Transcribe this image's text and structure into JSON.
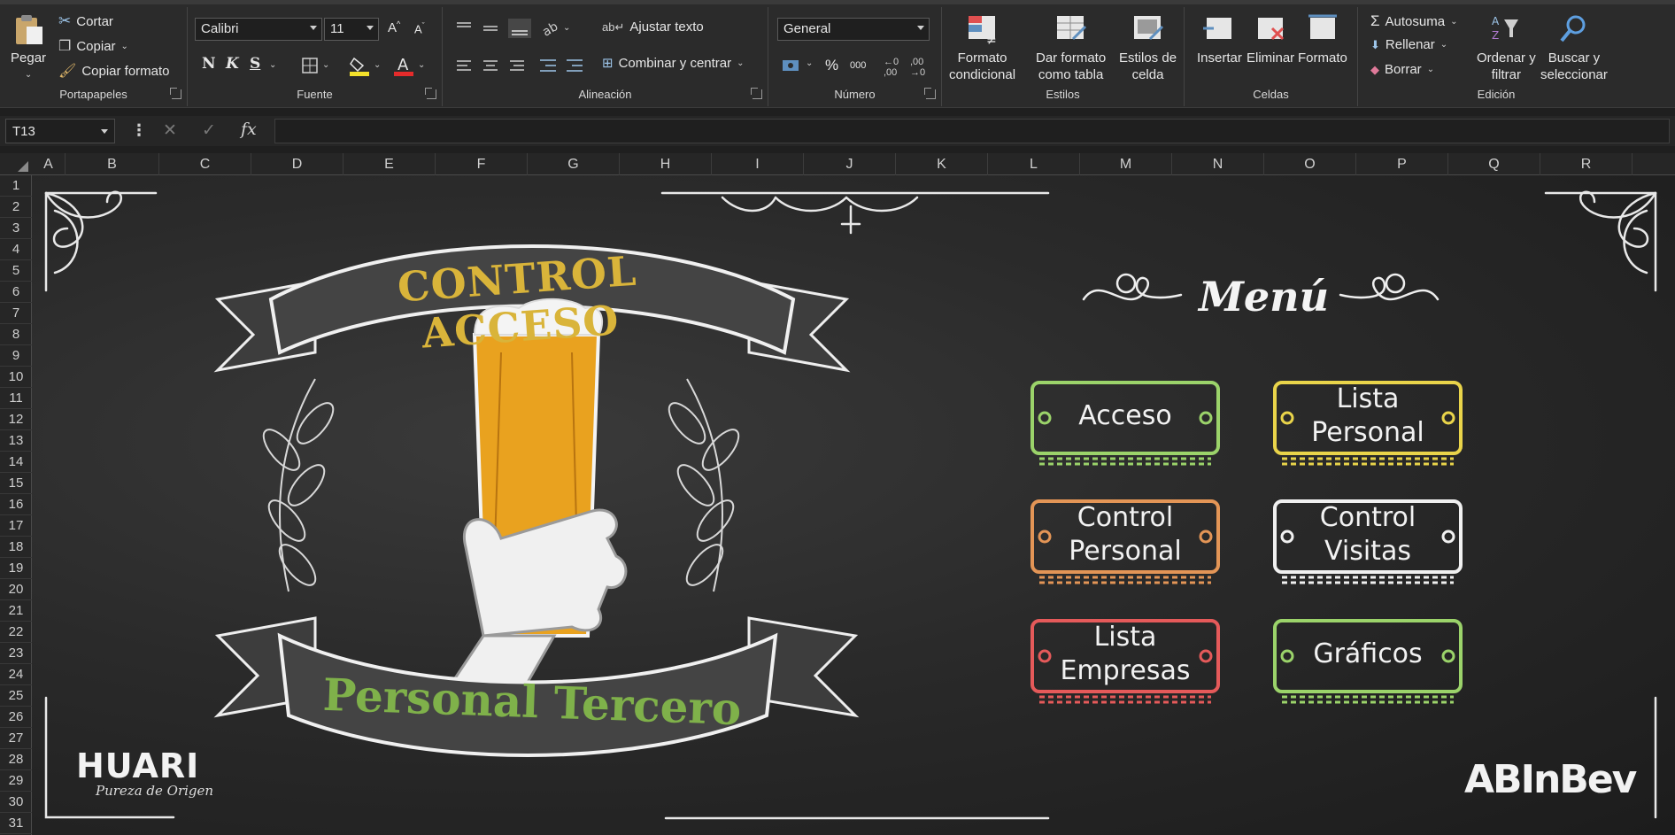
{
  "ribbon": {
    "clipboard": {
      "paste": "Pegar",
      "cut": "Cortar",
      "copy": "Copiar",
      "copy_format": "Copiar formato",
      "group": "Portapapeles"
    },
    "font": {
      "family": "Calibri",
      "size": "11",
      "bold": "N",
      "italic": "K",
      "underline": "S",
      "group": "Fuente"
    },
    "alignment": {
      "wrap": "Ajustar texto",
      "merge": "Combinar y centrar",
      "group": "Alineación"
    },
    "number": {
      "format": "General",
      "percent": "%",
      "thousands": "000",
      "group": "Número"
    },
    "styles": {
      "conditional": "Formato\ncondicional",
      "table": "Dar formato\ncomo tabla",
      "cell": "Estilos de\ncelda",
      "group": "Estilos"
    },
    "cells": {
      "insert": "Insertar",
      "delete": "Eliminar",
      "format": "Formato",
      "group": "Celdas"
    },
    "editing": {
      "autosum": "Autosuma",
      "fill": "Rellenar",
      "clear": "Borrar",
      "sort": "Ordenar y\nfiltrar",
      "find": "Buscar y\nseleccionar",
      "group": "Edición"
    }
  },
  "formula_bar": {
    "name_box": "T13",
    "fx": "fx",
    "value": ""
  },
  "columns": [
    "A",
    "B",
    "C",
    "D",
    "E",
    "F",
    "G",
    "H",
    "I",
    "J",
    "K",
    "L",
    "M",
    "N",
    "O",
    "P",
    "Q",
    "R"
  ],
  "rows": [
    "1",
    "2",
    "3",
    "4",
    "5",
    "6",
    "7",
    "8",
    "9",
    "10",
    "11",
    "12",
    "13",
    "14",
    "15",
    "16",
    "17",
    "18",
    "19",
    "20",
    "21",
    "22",
    "23",
    "24",
    "25",
    "26",
    "27",
    "28",
    "29",
    "30",
    "31"
  ],
  "board": {
    "banner_top": "CONTROL ACCESO",
    "banner_bottom": "Personal Tercero",
    "menu_title": "Menú",
    "buttons": [
      {
        "label": "Acceso",
        "color": "#9bd36a"
      },
      {
        "label": "Lista\nPersonal",
        "color": "#e9d44a"
      },
      {
        "label": "Control\nPersonal",
        "color": "#e39556"
      },
      {
        "label": "Control\nVisitas",
        "color": "#f0f0f0"
      },
      {
        "label": "Lista\nEmpresas",
        "color": "#e55a5a"
      },
      {
        "label": "Gráficos",
        "color": "#9bd36a"
      }
    ],
    "logo_left": "HUARI",
    "logo_left_sub": "Pureza de Origen",
    "logo_right": "ABInBev"
  },
  "colors": {
    "banner_top_text": "#d9b43a",
    "banner_bottom_text": "#7fb14a",
    "beer": "#e9a21f",
    "chalkboard": "#2a2a2a"
  }
}
